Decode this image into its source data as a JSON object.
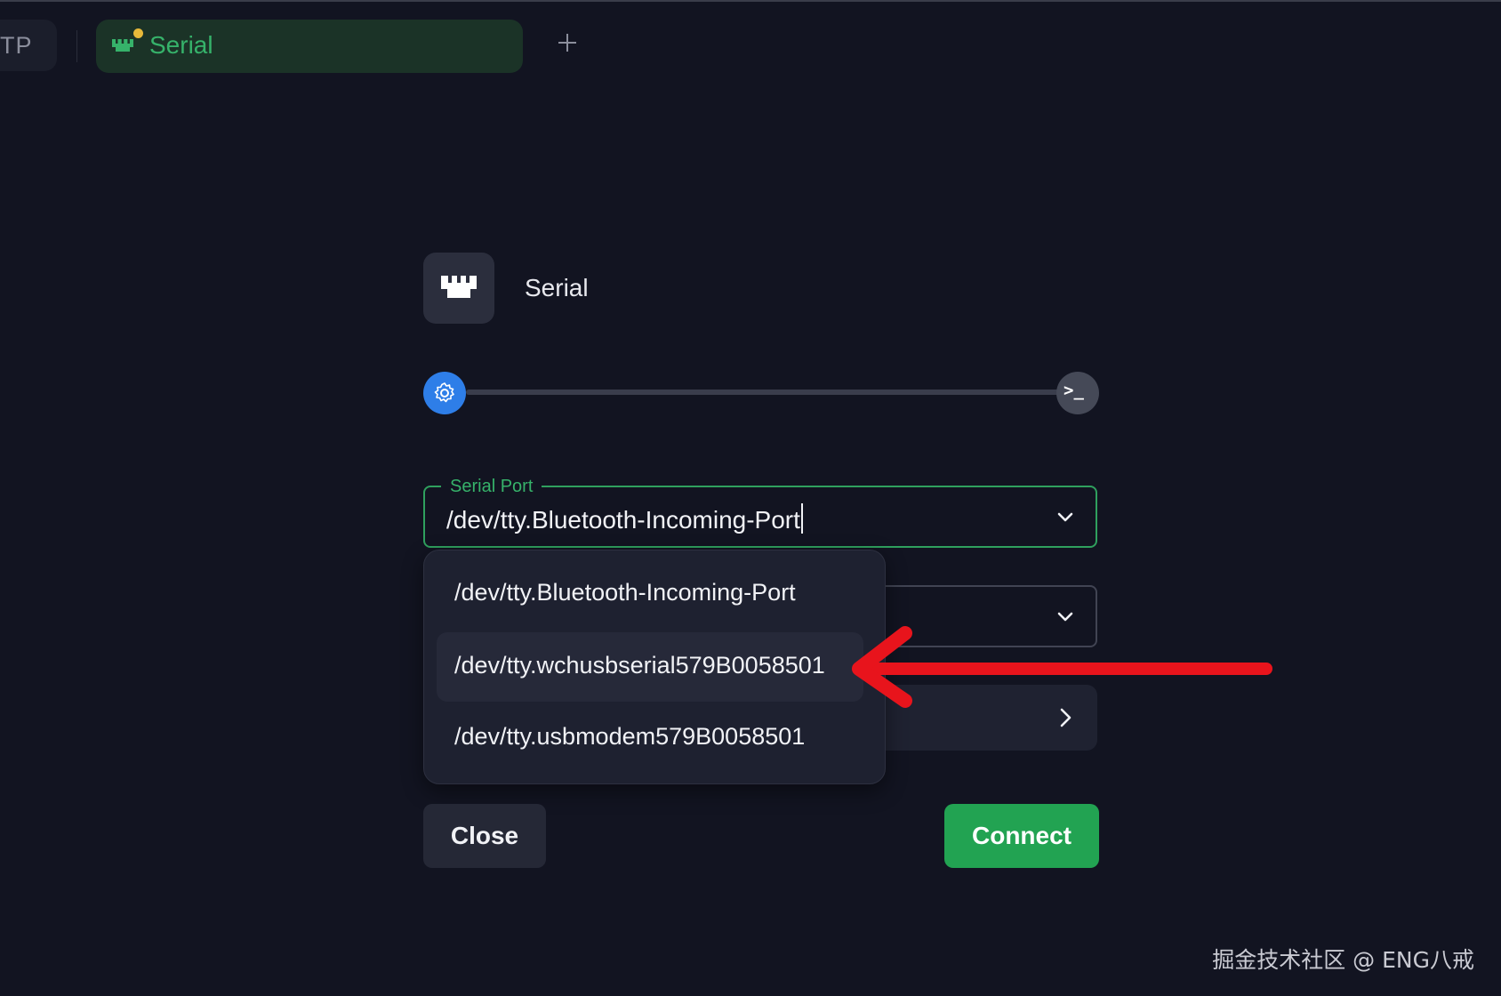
{
  "tabs": [
    {
      "label": "TP",
      "active": false
    },
    {
      "label": "Serial",
      "active": true,
      "icon": "serial-port-icon",
      "status_dot_color": "#e7b93a"
    }
  ],
  "add_tab_icon": "plus-icon",
  "header": {
    "icon": "serial-port-icon",
    "title": "Serial"
  },
  "stepper": {
    "steps": [
      "settings-gear-icon",
      "terminal-icon"
    ],
    "current_step": 1,
    "terminal_glyph": ">_"
  },
  "form": {
    "serial_port": {
      "label": "Serial Port",
      "value": "/dev/tty.Bluetooth-Incoming-Port"
    },
    "dropdown_options": [
      "/dev/tty.Bluetooth-Incoming-Port",
      "/dev/tty.wchusbserial579B0058501",
      "/dev/tty.usbmodem579B0058501"
    ],
    "highlighted_option_index": 1
  },
  "buttons": {
    "close": "Close",
    "connect": "Connect"
  },
  "colors": {
    "accent_green": "#22a352",
    "step_blue": "#2e7ee8",
    "annotation_red": "#e8141c"
  },
  "watermark": "掘金技术社区 @ ENG八戒"
}
